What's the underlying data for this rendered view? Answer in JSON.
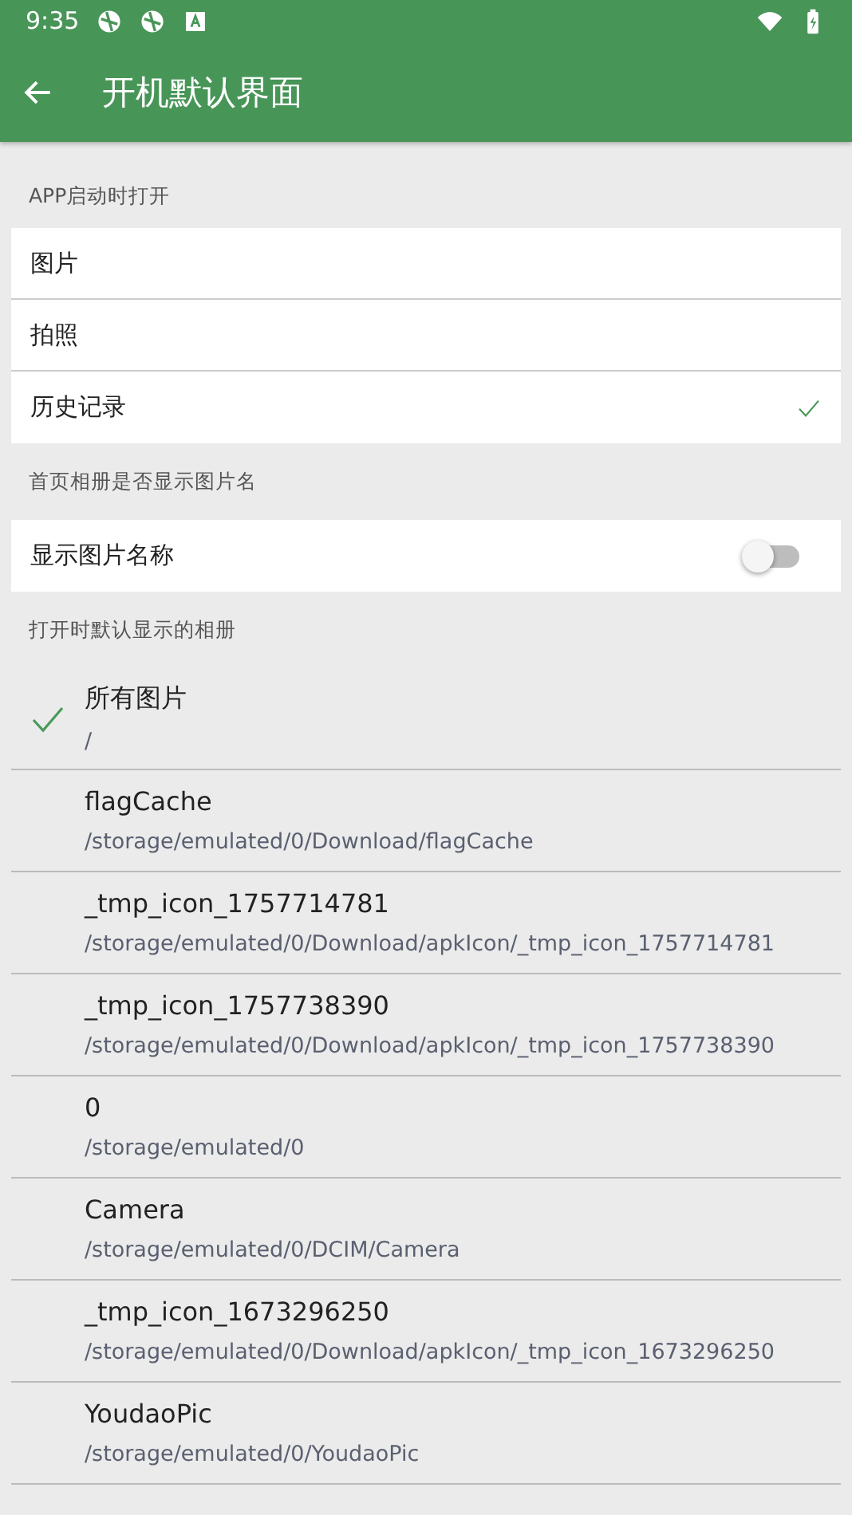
{
  "status_bar": {
    "time": "9:35"
  },
  "app_bar": {
    "title": "开机默认界面"
  },
  "startup_section": {
    "header": "APP启动时打开",
    "options": [
      {
        "label": "图片",
        "selected": false
      },
      {
        "label": "拍照",
        "selected": false
      },
      {
        "label": "历史记录",
        "selected": true
      }
    ]
  },
  "album_name_section": {
    "header": "首页相册是否显示图片名",
    "setting": {
      "label": "显示图片名称",
      "on": false
    }
  },
  "default_album_section": {
    "header": "打开时默认显示的相册",
    "albums": [
      {
        "name": "所有图片",
        "path": "/",
        "selected": true
      },
      {
        "name": "flagCache",
        "path": "/storage/emulated/0/Download/flagCache",
        "selected": false
      },
      {
        "name": "_tmp_icon_1757714781",
        "path": "/storage/emulated/0/Download/apkIcon/_tmp_icon_1757714781",
        "selected": false
      },
      {
        "name": "_tmp_icon_1757738390",
        "path": "/storage/emulated/0/Download/apkIcon/_tmp_icon_1757738390",
        "selected": false
      },
      {
        "name": "0",
        "path": "/storage/emulated/0",
        "selected": false
      },
      {
        "name": "Camera",
        "path": "/storage/emulated/0/DCIM/Camera",
        "selected": false
      },
      {
        "name": "_tmp_icon_1673296250",
        "path": "/storage/emulated/0/Download/apkIcon/_tmp_icon_1673296250",
        "selected": false
      },
      {
        "name": "YoudaoPic",
        "path": "/storage/emulated/0/YoudaoPic",
        "selected": false
      }
    ]
  }
}
